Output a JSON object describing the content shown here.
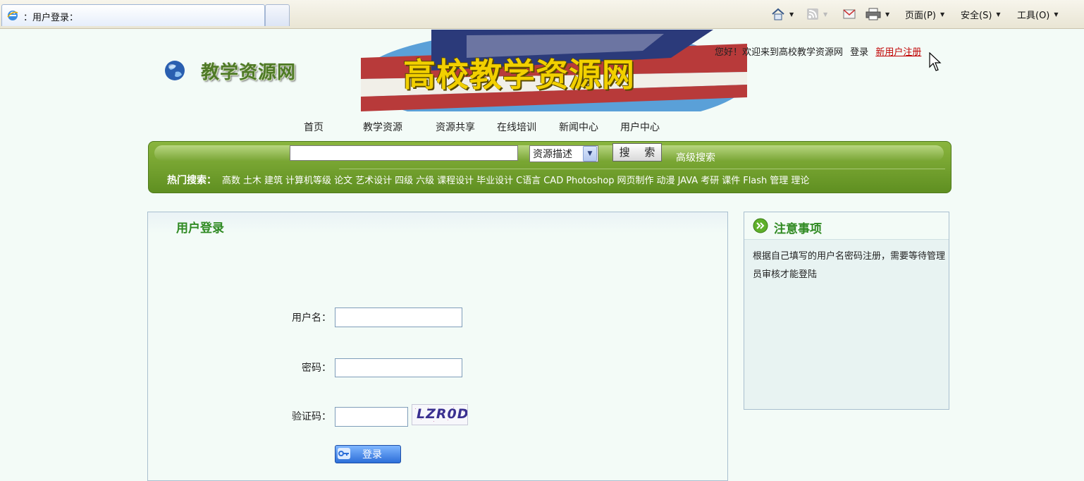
{
  "browser": {
    "tab_title": "：用户登录：",
    "toolbar": {
      "page_label": "页面(P)",
      "safety_label": "安全(S)",
      "tools_label": "工具(O)"
    }
  },
  "header": {
    "logo_text": "教学资源网",
    "banner_title": "高校教学资源网",
    "greeting": "您好！欢迎来到高校教学资源网",
    "login_link": "登录",
    "register_link": "新用户注册"
  },
  "nav": {
    "items": [
      "首页",
      "教学资源",
      "资源共享",
      "在线培训",
      "新闻中心",
      "用户中心"
    ]
  },
  "search": {
    "input_value": "",
    "select_value": "资源描述",
    "button_label": "搜  索",
    "advanced_label": "高级搜索",
    "hot_label": "热门搜索：",
    "hot_keywords": [
      "高数",
      "土木",
      "建筑",
      "计算机等级",
      "论文",
      "艺术设计",
      "四级",
      "六级",
      "课程设计",
      "毕业设计",
      "C语言",
      "CAD",
      "Photoshop",
      "网页制作",
      "动漫",
      "JAVA",
      "考研",
      "课件",
      "Flash",
      "管理",
      "理论"
    ]
  },
  "login": {
    "title": "用户登录",
    "username_label": "用户名：",
    "password_label": "密码：",
    "captcha_label": "验证码：",
    "captcha_text": "LZR0D",
    "submit_label": "登录"
  },
  "notice": {
    "title": "注意事项",
    "text": "根据自己填写的用户名密码注册，需要等待管理员审核才能登陆"
  },
  "colors": {
    "green_bar": "#6f9c2c",
    "title_green": "#2f8a22",
    "register_red": "#c00000",
    "page_bg": "#f3fbf7"
  }
}
